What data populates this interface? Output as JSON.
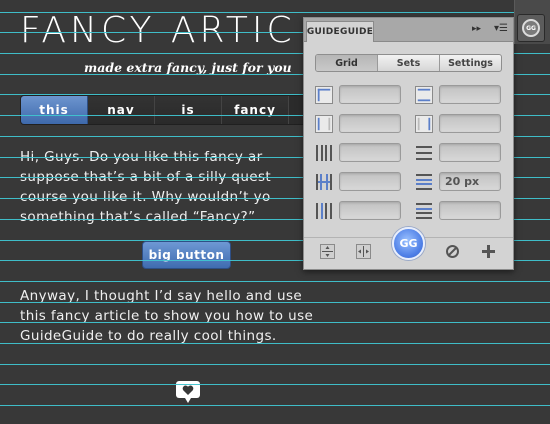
{
  "article": {
    "title": "FANCY ARTIC",
    "subtitle": "made extra fancy, just for you",
    "nav": [
      "this",
      "nav",
      "is",
      "fancy"
    ],
    "paragraph1_lines": [
      "Hi, Guys. Do you like this fancy ar",
      "suppose that’s a bit of a silly quest",
      "course you like it. Why wouldn’t yo",
      "something that’s called “Fancy?”"
    ],
    "big_button_label": "big button",
    "paragraph2_lines": [
      "Anyway, I thought I’d say hello and use",
      "this fancy article to show you how to use",
      "GuideGuide to do really cool things."
    ],
    "heart_icon": "heart-bubble-icon"
  },
  "panel": {
    "tab_title": "GUIDEGUIDE",
    "collapse_glyph": "▸▸",
    "menu_glyph": "▾☰",
    "segments": [
      {
        "label": "Grid",
        "active": true
      },
      {
        "label": "Sets",
        "active": false
      },
      {
        "label": "Settings",
        "active": false
      }
    ],
    "rows": [
      {
        "left_icon": "margin-left-right-icon",
        "left_value": "",
        "right_icon": "margin-top-bottom-icon",
        "right_value": ""
      },
      {
        "left_icon": "margin-side-icon",
        "left_value": "",
        "right_icon": "margin-edge-icon",
        "right_value": ""
      },
      {
        "left_icon": "columns-icon",
        "left_value": "",
        "right_icon": "rows-icon",
        "right_value": ""
      },
      {
        "left_icon": "column-width-icon",
        "left_value": "",
        "right_icon": "row-height-icon",
        "right_value": "20 px"
      },
      {
        "left_icon": "gutter-icon",
        "left_value": "",
        "right_icon": "row-gutter-icon",
        "right_value": ""
      }
    ],
    "gg_label": "GG",
    "footer_icons": [
      "horizontal-midpoint-icon",
      "vertical-midpoint-icon",
      "clear-guides-icon",
      "add-guides-icon"
    ]
  },
  "dock": {
    "gg_label": "GG"
  },
  "colors": {
    "guide": "#3fc4d0",
    "background": "#383838",
    "accent": "#4f7ec4"
  }
}
